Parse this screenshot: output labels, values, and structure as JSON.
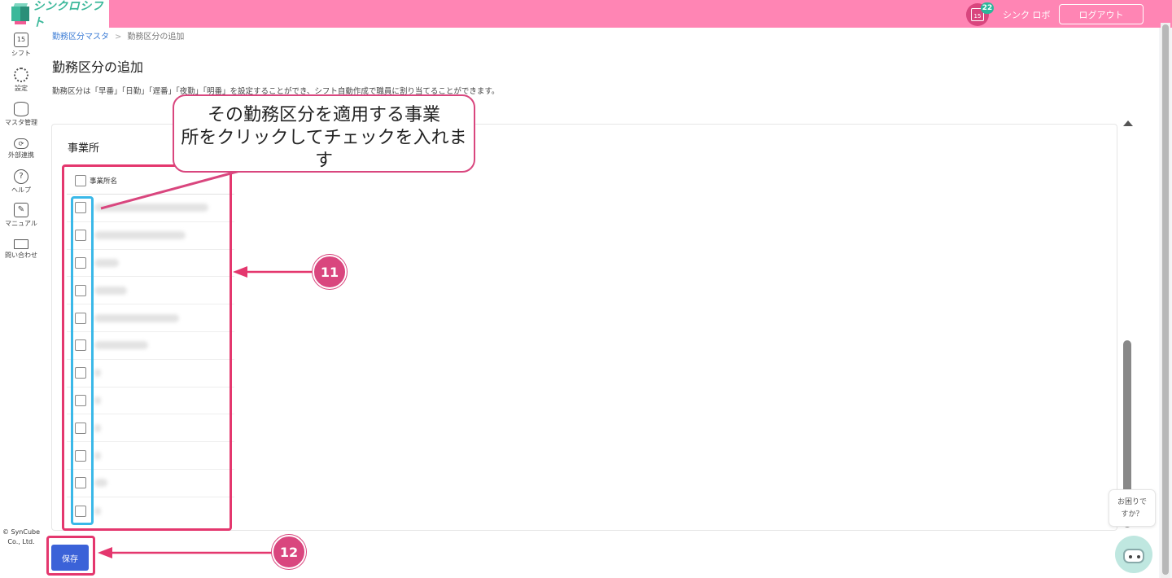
{
  "header": {
    "app_name": "シンクロシフト",
    "calendar_day": "15",
    "notification_count": "22",
    "user_name": "シンク ロボ",
    "logout_label": "ログアウト"
  },
  "sidebar": {
    "items": [
      {
        "label": "シフト",
        "icon": "calendar-icon",
        "glyph": "15"
      },
      {
        "label": "設定",
        "icon": "gear-icon",
        "glyph": ""
      },
      {
        "label": "マスタ管理",
        "icon": "database-icon",
        "glyph": ""
      },
      {
        "label": "外部連携",
        "icon": "cloud-icon",
        "glyph": "⟳"
      },
      {
        "label": "ヘルプ",
        "icon": "help-icon",
        "glyph": "?"
      },
      {
        "label": "マニュアル",
        "icon": "pencil-icon",
        "glyph": "✎"
      },
      {
        "label": "問い合わせ",
        "icon": "mail-icon",
        "glyph": ""
      }
    ],
    "copyright_line1": "© SynCube",
    "copyright_line2": "Co., Ltd."
  },
  "breadcrumb": {
    "parent": "勤務区分マスタ",
    "separator": ">",
    "current": "勤務区分の追加"
  },
  "page": {
    "title": "勤務区分の追加",
    "description": "勤務区分は「早番」「日勤」「遅番」「夜勤」「明番」を設定することができ、シフト自動作成で職員に割り当てることができます。"
  },
  "section": {
    "title": "事業所",
    "column_header": "事業所名"
  },
  "save_label": "保存",
  "help": {
    "line1": "お困りで",
    "line2": "すか？"
  },
  "annotations": {
    "callout_line1": "その勤務区分を適用する事業",
    "callout_line2": "所をクリックしてチェックを入れます",
    "step1": "11",
    "step2": "12"
  },
  "colors": {
    "header": "#ff85b4",
    "brand_green": "#3bb89a",
    "primary_button": "#3b62d8",
    "annotation_red": "#e4376e",
    "annotation_blue": "#3ab8e8"
  }
}
